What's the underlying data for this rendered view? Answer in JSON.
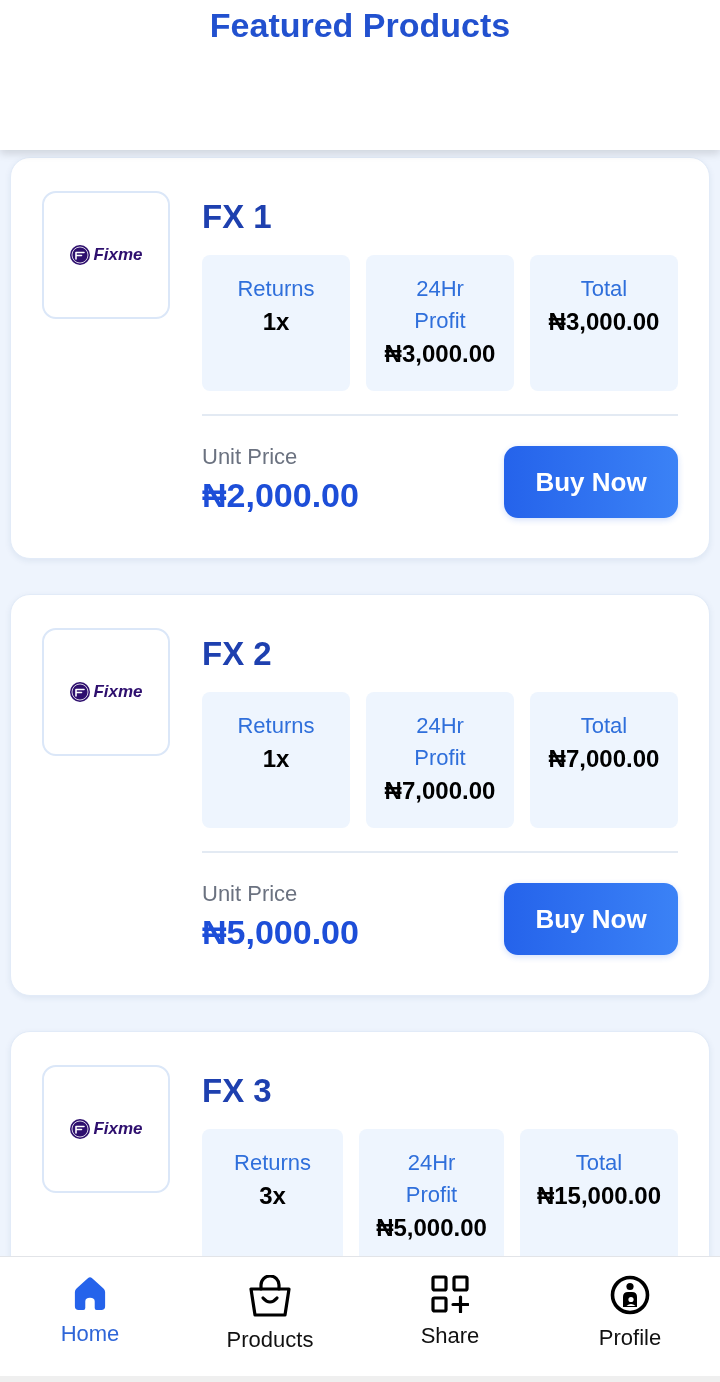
{
  "header": {
    "title": "Featured Products"
  },
  "products": [
    {
      "logo_text": "Fixme",
      "name": "FX 1",
      "stats": [
        {
          "label": "Returns",
          "value": "1x"
        },
        {
          "label": "24Hr Profit",
          "value": "₦3,000.00"
        },
        {
          "label": "Total",
          "value": "₦3,000.00"
        }
      ],
      "price_label": "Unit Price",
      "price": "₦2,000.00",
      "button": "Buy Now"
    },
    {
      "logo_text": "Fixme",
      "name": "FX 2",
      "stats": [
        {
          "label": "Returns",
          "value": "1x"
        },
        {
          "label": "24Hr Profit",
          "value": "₦7,000.00"
        },
        {
          "label": "Total",
          "value": "₦7,000.00"
        }
      ],
      "price_label": "Unit Price",
      "price": "₦5,000.00",
      "button": "Buy Now"
    },
    {
      "logo_text": "Fixme",
      "name": "FX 3",
      "stats": [
        {
          "label": "Returns",
          "value": "3x"
        },
        {
          "label": "24Hr Profit",
          "value": "₦5,000.00"
        },
        {
          "label": "Total",
          "value": "₦15,000.00"
        }
      ]
    }
  ],
  "bottom_nav": [
    {
      "label": "Home",
      "selected": true
    },
    {
      "label": "Products",
      "selected": false
    },
    {
      "label": "Share",
      "selected": false
    },
    {
      "label": "Profile",
      "selected": false
    }
  ]
}
